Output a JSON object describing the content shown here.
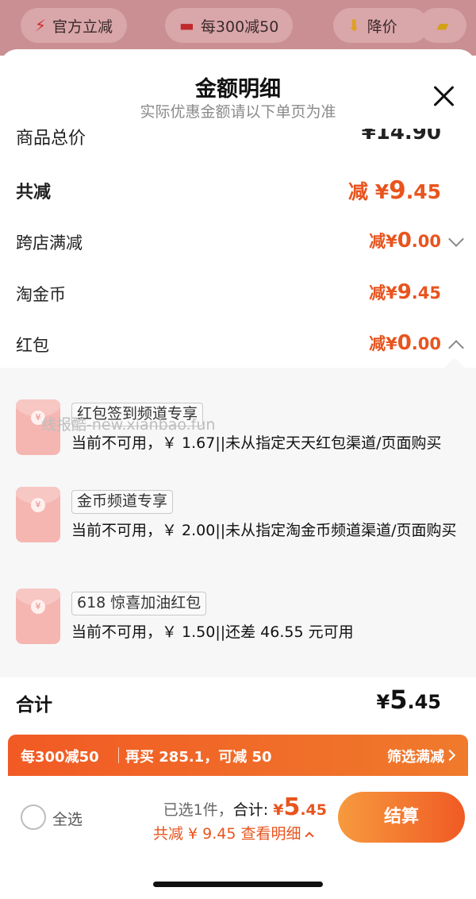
{
  "topbar": {
    "chips": [
      {
        "icon": "lightning-icon",
        "label": "官方立减"
      },
      {
        "icon": "shop-icon",
        "label": "每300减50"
      },
      {
        "icon": "arrow-down-icon",
        "label": "降价"
      },
      {
        "icon": "folder-icon",
        "label": ""
      }
    ]
  },
  "sheet": {
    "title": "金额明细",
    "subtitle": "实际优惠金额请以下单页为准",
    "clipped_row": {
      "label": "商品总价",
      "value": "¥14.90"
    }
  },
  "rows": {
    "total_reduce": {
      "label": "共减",
      "prefix": "减 ¥",
      "int": "9",
      "dec": ".45"
    },
    "cross_store": {
      "label": "跨店满减",
      "prefix": "减¥",
      "int": "0",
      "dec": ".00"
    },
    "coins": {
      "label": "淘金币",
      "prefix": "减¥",
      "int": "9",
      "dec": ".45"
    },
    "red_packet": {
      "label": "红包",
      "prefix": "减¥",
      "int": "0",
      "dec": ".00"
    }
  },
  "coupons": [
    {
      "tag": "红包签到频道专享",
      "reason": "当前不可用，￥ 1.67||未从指定天天红包渠道/页面购买"
    },
    {
      "tag": "金币频道专享",
      "reason": "当前不可用，￥ 2.00||未从指定淘金币频道渠道/页面购买"
    },
    {
      "tag": "618 惊喜加油红包",
      "reason": "当前不可用，￥ 1.50||还差 46.55 元可用"
    }
  ],
  "watermark": "线报酷-new.xianbao.fun",
  "total": {
    "label": "合计",
    "prefix": "¥",
    "int": "5",
    "dec": ".45"
  },
  "promo": {
    "left": "每300减50",
    "middle": "再买 285.1，可减 50",
    "right": "筛选满减"
  },
  "bottom": {
    "select_all": "全选",
    "selected_text": "已选1件，",
    "total_label": "合计:",
    "currency": "¥",
    "int": "5",
    "dec": ".45",
    "saved": "共减 ¥ 9.45",
    "view_detail": "查看明细",
    "checkout": "结算"
  },
  "colors": {
    "accent": "#e8541e",
    "promo_bg": "#f15a24",
    "panel_bg": "#f7f7f7"
  }
}
